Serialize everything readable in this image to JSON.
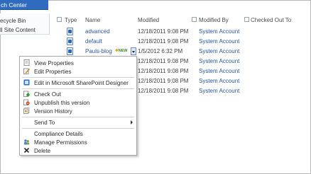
{
  "nav": {
    "tab_label": "ch Center"
  },
  "left_nav": {
    "items": [
      "ecycle Bin",
      "ll Site Content"
    ]
  },
  "list": {
    "columns": {
      "type": "Type",
      "name": "Name",
      "modified": "Modified",
      "modified_by": "Modified By",
      "checked_out_to": "Checked Out To"
    },
    "rows": [
      {
        "name": "advanced",
        "modified": "12/18/2011 9:08 PM",
        "modified_by": "System Account"
      },
      {
        "name": "default",
        "modified": "12/18/2011 9:08 PM",
        "modified_by": "System Account"
      },
      {
        "name": "Pauls-blog",
        "new_badge": "NEW",
        "modified": "1/5/2012 6:32 PM",
        "modified_by": "System Account"
      },
      {
        "modified": "12/18/2011 9:08 PM",
        "modified_by": "System Account"
      },
      {
        "modified": "12/18/2011 9:08 PM",
        "modified_by": "System Account"
      },
      {
        "modified": "12/18/2011 9:08 PM",
        "modified_by": "System Account"
      },
      {
        "modified": "12/18/2011 9:08 PM",
        "modified_by": "System Account"
      }
    ]
  },
  "context_menu": {
    "items": [
      {
        "label": "View Properties",
        "icon": "view-properties-icon"
      },
      {
        "label": "Edit Properties",
        "icon": "edit-properties-icon"
      },
      {
        "label": "Edit in Microsoft SharePoint Designer",
        "icon": "sharepoint-designer-icon"
      },
      {
        "label": "Check Out",
        "icon": "check-out-icon"
      },
      {
        "label": "Unpublish this version",
        "icon": "unpublish-icon"
      },
      {
        "label": "Version History",
        "icon": "version-history-icon"
      },
      {
        "label": "Send To",
        "icon": ""
      },
      {
        "label": "Compliance Details",
        "icon": ""
      },
      {
        "label": "Manage Permissions",
        "icon": "manage-permissions-icon"
      },
      {
        "label": "Delete",
        "icon": "delete-icon"
      }
    ]
  },
  "colors": {
    "accent": "#2f6bbf",
    "link": "#2a58a6",
    "new_badge": "#3a8a2c"
  }
}
